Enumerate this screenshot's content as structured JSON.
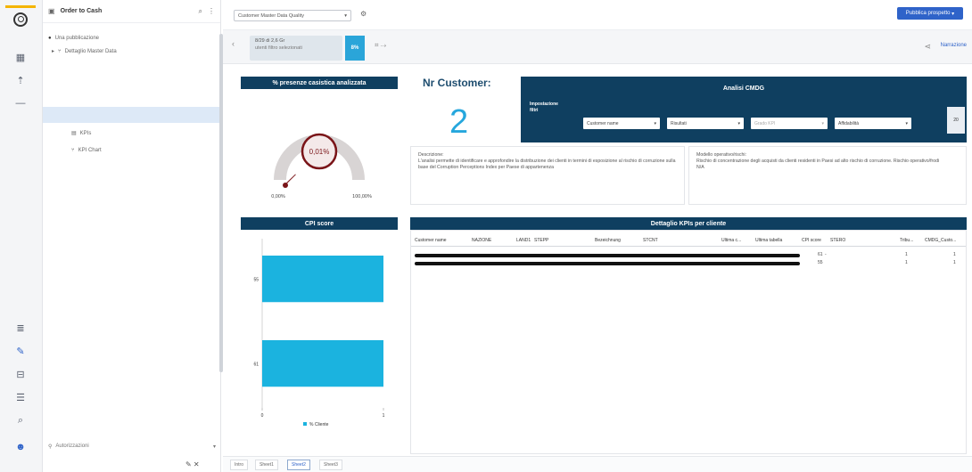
{
  "app": {
    "panel_title": "Order to Cash",
    "sheet_selector": "Customer Master Data Quality",
    "publish_button": "Pubblica prospetto"
  },
  "tree": {
    "root": "Una pubblicazione",
    "group": "Dettaglio Master Data",
    "items": [
      "KPIs",
      "KPI Chart"
    ],
    "footer": "Autorizzazioni"
  },
  "selection": {
    "line1": "8/29 di 2,6 Gr",
    "line2": "utenti filtro selezionati",
    "percent": "8%"
  },
  "notes_label": "Narrazione",
  "gauge": {
    "title": "% presenze casistica analizzata",
    "value_label": "0,01%",
    "min_label": "0,00%",
    "max_label": "100,00%",
    "fraction": 0.0001
  },
  "kpi": {
    "title": "Nr Customer:",
    "value": "2"
  },
  "filters": {
    "title": "Analisi CMDG",
    "label_line1": "Impostazione",
    "label_line2": "filtri",
    "dropdowns": [
      "Customer name",
      "Risultati",
      "Grado KPI",
      "Affidabilità"
    ],
    "side_label": "20"
  },
  "descriptions": {
    "left_title": "Descrizione:",
    "left_body": "L'analisi permette di identificare e approfondire la distribuzione dei clienti in termini di esposizione al rischio di corruzione sulla base del Corruption Perceptions Index per Paese di appartenenza",
    "right_title": "Modello operativo/rischi:",
    "right_body": "Rischio di concentrazione degli acquisti da clienti residenti in Paesi ad alto rischio di corruzione. Rischio operativo/frodi",
    "right_tail": "N/A"
  },
  "cpi": {
    "title": "CPI score",
    "legend": "% Cliente"
  },
  "chart_data": {
    "type": "bar",
    "orientation": "horizontal",
    "title": "CPI score",
    "categories": [
      "55",
      "61"
    ],
    "values": [
      1,
      1
    ],
    "xlim": [
      0,
      1
    ],
    "x_ticks": [
      "0",
      "1"
    ],
    "legend": "% Cliente"
  },
  "table": {
    "title": "Dettaglio KPIs per cliente",
    "headers": [
      "Customer name",
      "NAZIONE",
      "LAND1",
      "STEPP",
      "Bezeichnung",
      "STCNT",
      "Ultima c...",
      "Ultima tabella",
      "CPI score",
      "STERO",
      "Tribu...",
      "CMDG_Custo..."
    ],
    "rows": [
      {
        "cpi": "61",
        "dash": "-",
        "trib": "1",
        "last": "1"
      },
      {
        "cpi": "55",
        "dash": "",
        "trib": "1",
        "last": "1"
      }
    ]
  },
  "sheets": [
    "Intro",
    "Sheet1",
    "Sheet2",
    "Sheet3"
  ]
}
